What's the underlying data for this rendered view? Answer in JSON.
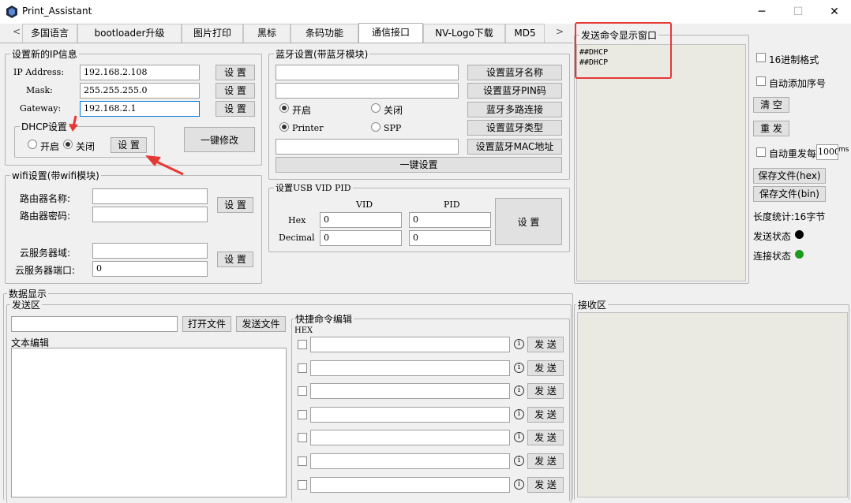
{
  "window": {
    "title": "Print_Assistant",
    "minimize": "─",
    "maximize": "☐",
    "close": "✕"
  },
  "tabs": [
    "多国语言",
    "bootloader升级",
    "图片打印",
    "黑标",
    "条码功能",
    "通信接口",
    "NV-Logo下载",
    "MD5"
  ],
  "tab_prev": "<",
  "tab_next": ">",
  "ip": {
    "legend": "设置新的IP信息",
    "address_label": "IP Address:",
    "address_value": "192.168.2.108",
    "mask_label": "Mask:",
    "mask_value": "255.255.255.0",
    "gateway_label": "Gateway:",
    "gateway_value": "192.168.2.1",
    "set_label": "设 置",
    "dhcp_legend": "DHCP设置",
    "dhcp_on": "开启",
    "dhcp_off": "关闭",
    "dhcp_set": "设 置",
    "one_click": "一键修改"
  },
  "wifi": {
    "legend": "wifi设置(带wifi模块)",
    "router_name_label": "路由器名称:",
    "router_name_value": "",
    "router_pwd_label": "路由器密码:",
    "router_pwd_value": "",
    "cloud_domain_label": "云服务器域:",
    "cloud_domain_value": "",
    "cloud_port_label": "云服务器端口:",
    "cloud_port_value": "0",
    "set_label": "设 置"
  },
  "bt": {
    "legend": "蓝牙设置(带蓝牙模块)",
    "name_value": "",
    "pin_value": "",
    "mac_value": "",
    "set_name": "设置蓝牙名称",
    "set_pin": "设置蓝牙PIN码",
    "multi": "蓝牙多路连接",
    "set_type": "设置蓝牙类型",
    "set_mac": "设置蓝牙MAC地址",
    "on": "开启",
    "off": "关闭",
    "printer": "Printer",
    "spp": "SPP",
    "one_click": "一键设置"
  },
  "usb": {
    "legend": "设置USB VID PID",
    "vid": "VID",
    "pid": "PID",
    "hex": "Hex",
    "decimal": "Decimal",
    "hex_vid": "0",
    "hex_pid": "0",
    "dec_vid": "0",
    "dec_pid": "0",
    "set_label": "设 置"
  },
  "cmd_display": {
    "legend": "发送命令显示窗口",
    "text": "##DHCP\n##DHCP"
  },
  "options": {
    "hex_format": "16进制格式",
    "auto_seq": "自动添加序号",
    "clear": "清 空",
    "resend": "重 发",
    "auto_resend": "自动重发每",
    "auto_resend_value": "1000",
    "ms": "ms",
    "save_hex": "保存文件(hex)",
    "save_bin": "保存文件(bin)",
    "length": "长度统计:16字节",
    "send_status": "发送状态",
    "connect_status": "连接状态",
    "send_color": "#000000",
    "connect_color": "#1e9a1e"
  },
  "data": {
    "legend": "数据显示",
    "send_area": "发送区",
    "file_path": "",
    "open_file": "打开文件",
    "send_file": "发送文件",
    "text_edit": "文本编辑",
    "quick_legend": "快捷命令编辑",
    "hex": "HEX",
    "send_label": "发 送",
    "quick_commands": [
      "",
      "",
      "",
      "",
      "",
      "",
      ""
    ],
    "receive_area": "接收区"
  },
  "icons": {
    "info": "i"
  }
}
